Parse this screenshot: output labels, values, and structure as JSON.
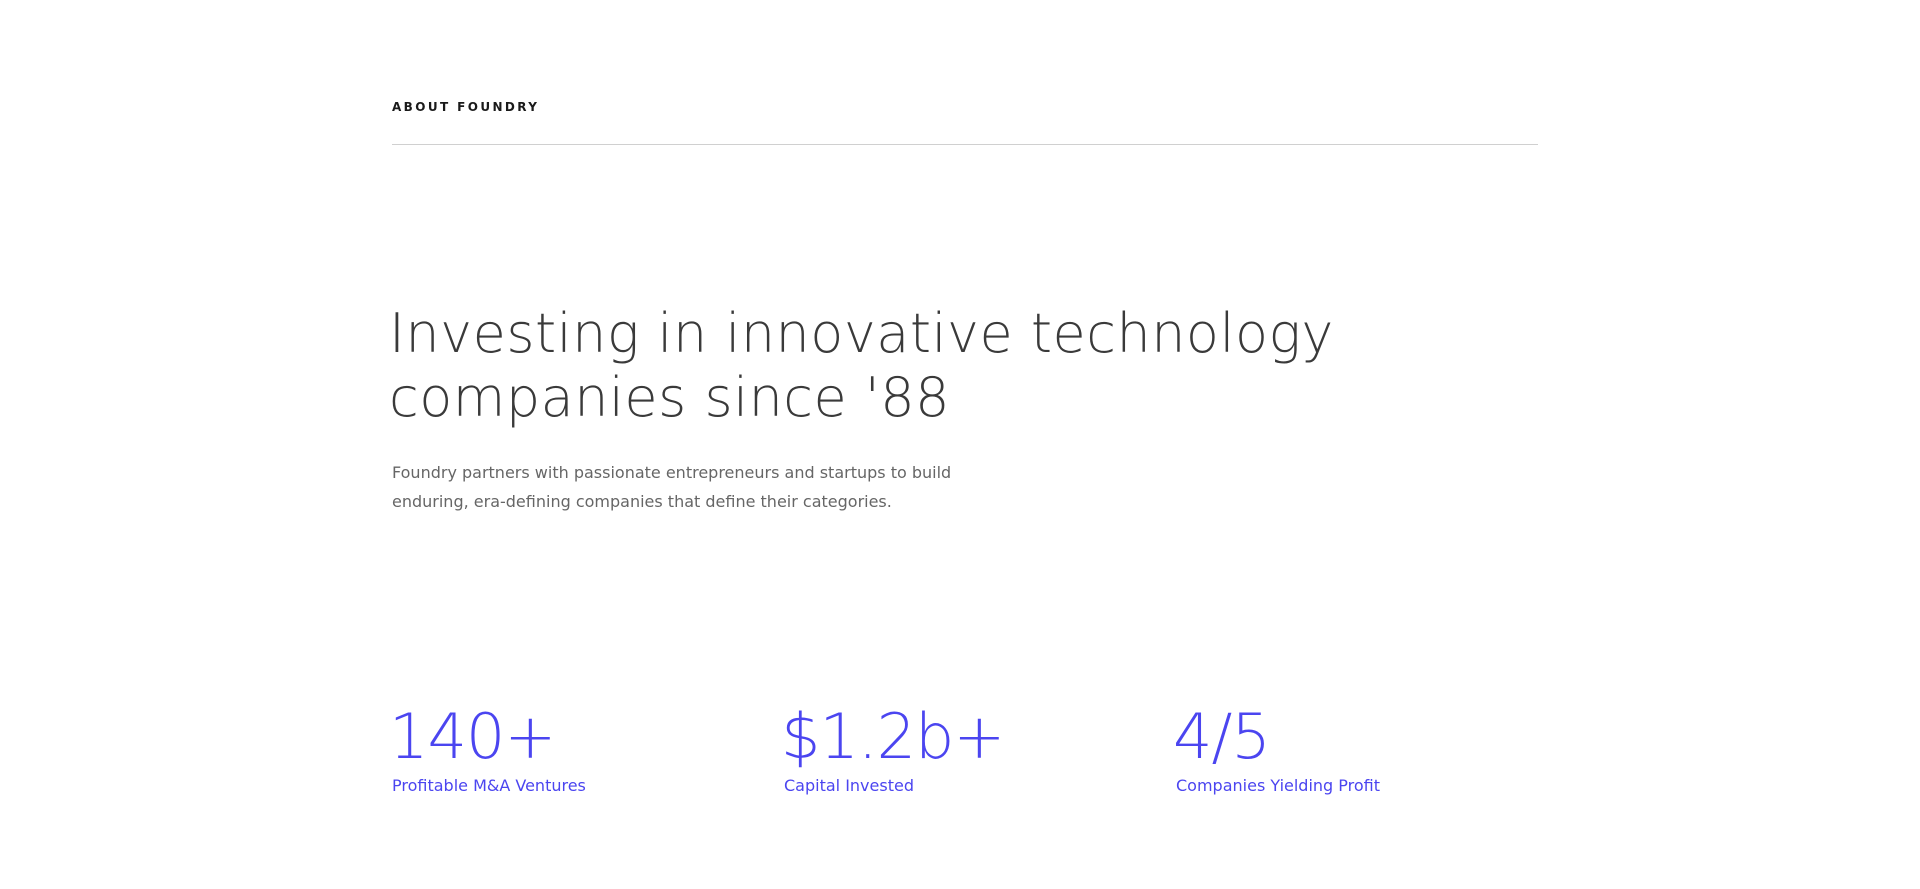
{
  "about": {
    "eyebrow": "ABOUT FOUNDRY"
  },
  "hero": {
    "headline_line1": "Investing in innovative technology",
    "headline_line2": "companies since '88",
    "intro_line1": "Foundry partners with passionate entrepreneurs and startups to build",
    "intro_line2": "enduring, era-defining companies that define their categories."
  },
  "stats": [
    {
      "value": "140+",
      "label": "Profitable M&A Ventures"
    },
    {
      "value": "$1.2b+",
      "label": "Capital Invested"
    },
    {
      "value": "4/5",
      "label": "Companies Yielding Profit"
    }
  ],
  "colors": {
    "accent": "#4b45f0",
    "headline": "#3a3a3a",
    "body_text": "#666666",
    "divider": "#d0d0d0"
  }
}
